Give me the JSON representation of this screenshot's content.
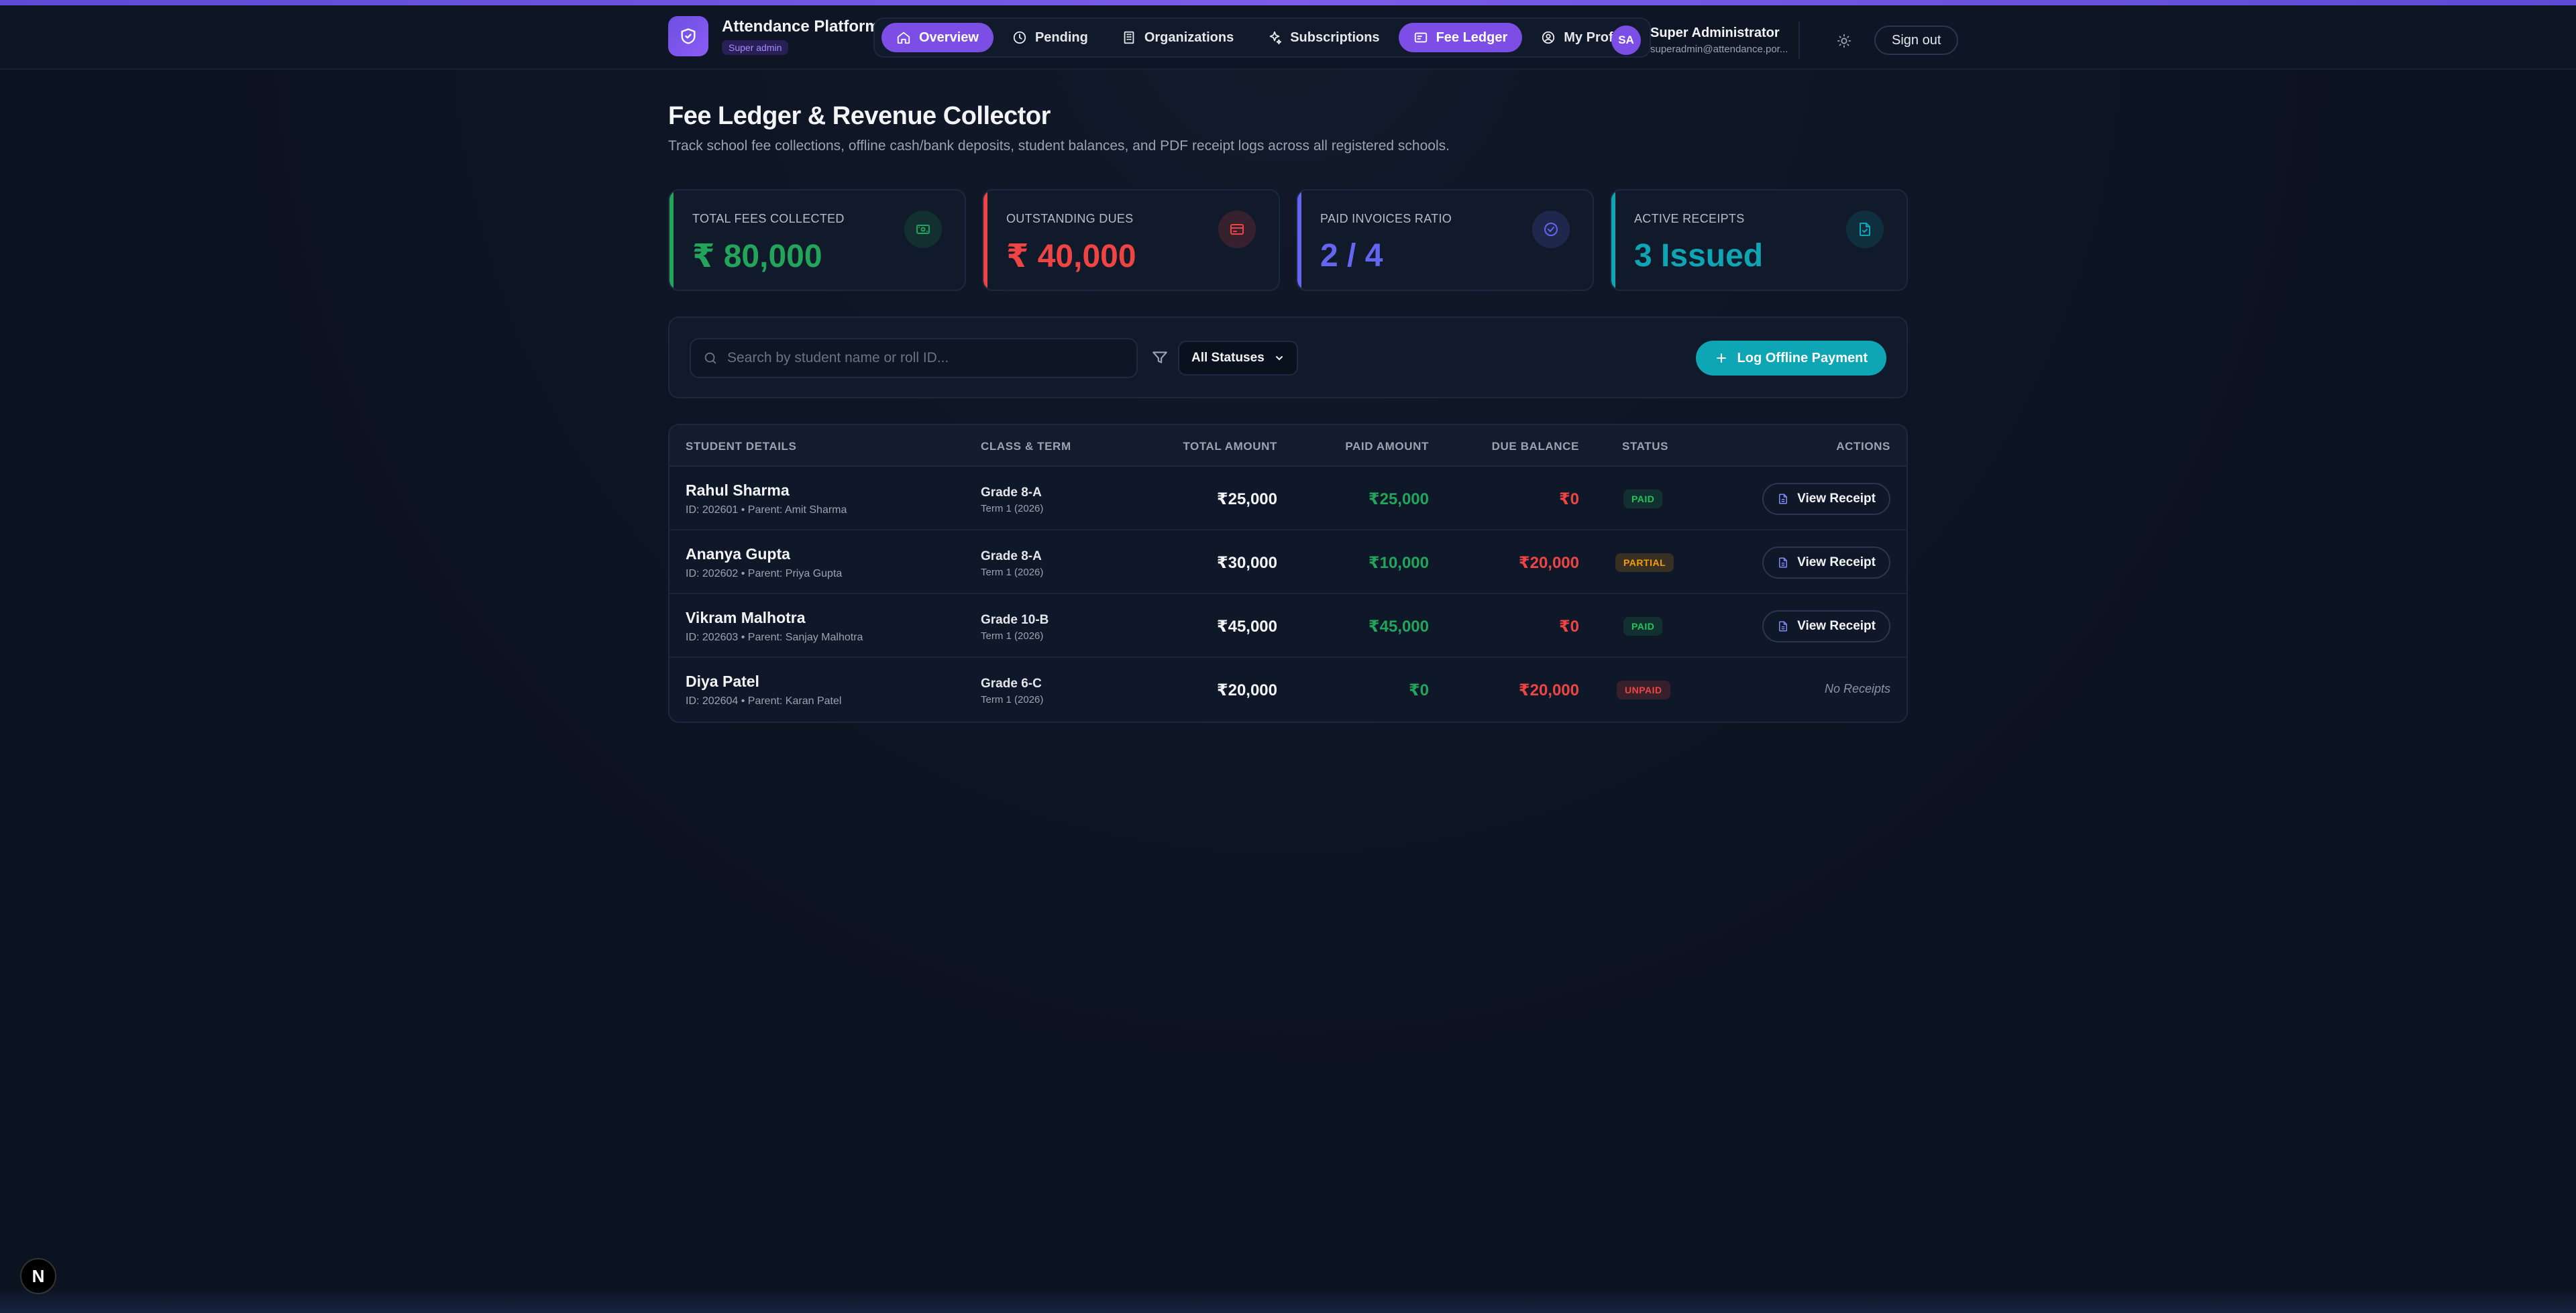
{
  "brand": {
    "title": "Attendance Platform",
    "badge": "Super admin"
  },
  "nav": {
    "items": [
      {
        "label": "Overview",
        "icon": "home-icon",
        "active": true
      },
      {
        "label": "Pending",
        "icon": "clock-icon",
        "active": false
      },
      {
        "label": "Organizations",
        "icon": "building-icon",
        "active": false
      },
      {
        "label": "Subscriptions",
        "icon": "sparkle-icon",
        "active": false
      },
      {
        "label": "Fee Ledger",
        "icon": "receipt-icon",
        "active": true
      },
      {
        "label": "My Profile",
        "icon": "user-circle-icon",
        "active": false
      }
    ]
  },
  "user": {
    "initials": "SA",
    "name": "Super Administrator",
    "email": "superadmin@attendance.por..."
  },
  "header": {
    "signout_label": "Sign out"
  },
  "page": {
    "title": "Fee Ledger & Revenue Collector",
    "subtitle": "Track school fee collections, offline cash/bank deposits, student balances, and PDF receipt logs across all registered schools."
  },
  "stats": [
    {
      "label": "TOTAL FEES COLLECTED",
      "value": "₹ 80,000",
      "color": "#22a55a",
      "icon": "banknote-icon"
    },
    {
      "label": "OUTSTANDING DUES",
      "value": "₹ 40,000",
      "color": "#ef4444",
      "icon": "credit-card-icon"
    },
    {
      "label": "PAID INVOICES RATIO",
      "value": "2 / 4",
      "color": "#6366f1",
      "icon": "check-circle-icon"
    },
    {
      "label": "ACTIVE RECEIPTS",
      "value": "3 Issued",
      "color": "#0ea5b4",
      "icon": "file-check-icon"
    }
  ],
  "filters": {
    "search_placeholder": "Search by student name or roll ID...",
    "status_selected": "All Statuses",
    "log_button": "Log Offline Payment"
  },
  "table": {
    "headers": {
      "student": "STUDENT DETAILS",
      "class": "CLASS & TERM",
      "total": "TOTAL AMOUNT",
      "paid": "PAID AMOUNT",
      "due": "DUE BALANCE",
      "status": "STATUS",
      "actions": "ACTIONS"
    },
    "rows": [
      {
        "name": "Rahul Sharma",
        "sub": "ID: 202601 • Parent: Amit Sharma",
        "grade": "Grade 8-A",
        "term": "Term 1 (2026)",
        "total": "₹25,000",
        "paid": "₹25,000",
        "due": "₹0",
        "status": "PAID",
        "action": "View Receipt"
      },
      {
        "name": "Ananya Gupta",
        "sub": "ID: 202602 • Parent: Priya Gupta",
        "grade": "Grade 8-A",
        "term": "Term 1 (2026)",
        "total": "₹30,000",
        "paid": "₹10,000",
        "due": "₹20,000",
        "status": "PARTIAL",
        "action": "View Receipt"
      },
      {
        "name": "Vikram Malhotra",
        "sub": "ID: 202603 • Parent: Sanjay Malhotra",
        "grade": "Grade 10-B",
        "term": "Term 1 (2026)",
        "total": "₹45,000",
        "paid": "₹45,000",
        "due": "₹0",
        "status": "PAID",
        "action": "View Receipt"
      },
      {
        "name": "Diya Patel",
        "sub": "ID: 202604 • Parent: Karan Patel",
        "grade": "Grade 6-C",
        "term": "Term 1 (2026)",
        "total": "₹20,000",
        "paid": "₹0",
        "due": "₹20,000",
        "status": "UNPAID",
        "action": "No Receipts"
      }
    ]
  },
  "dev_badge": "N"
}
